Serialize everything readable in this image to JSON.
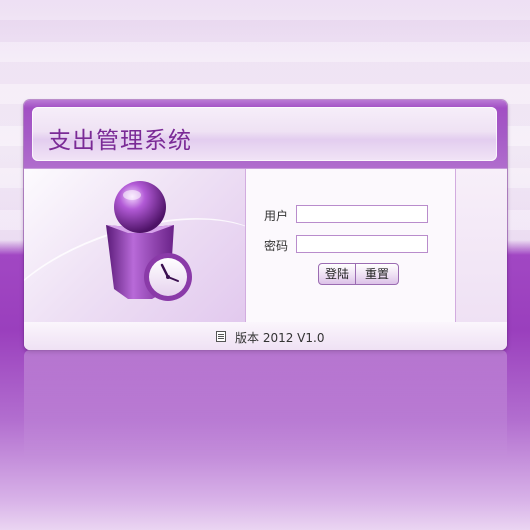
{
  "app": {
    "title": "支出管理系统"
  },
  "login_form": {
    "username_label": "用户",
    "username_value": "",
    "password_label": "密码",
    "password_value": "",
    "login_button": "登陆",
    "reset_button": "重置"
  },
  "footer": {
    "icon": "document-icon",
    "version": "版本 2012 V1.0"
  },
  "illustration": {
    "icon": "user-clock-icon"
  },
  "colors": {
    "accent": "#a24fc4",
    "title_text": "#7a2a96",
    "background_lower": "#9a3fbd",
    "background_upper": "#f3e9f7"
  }
}
